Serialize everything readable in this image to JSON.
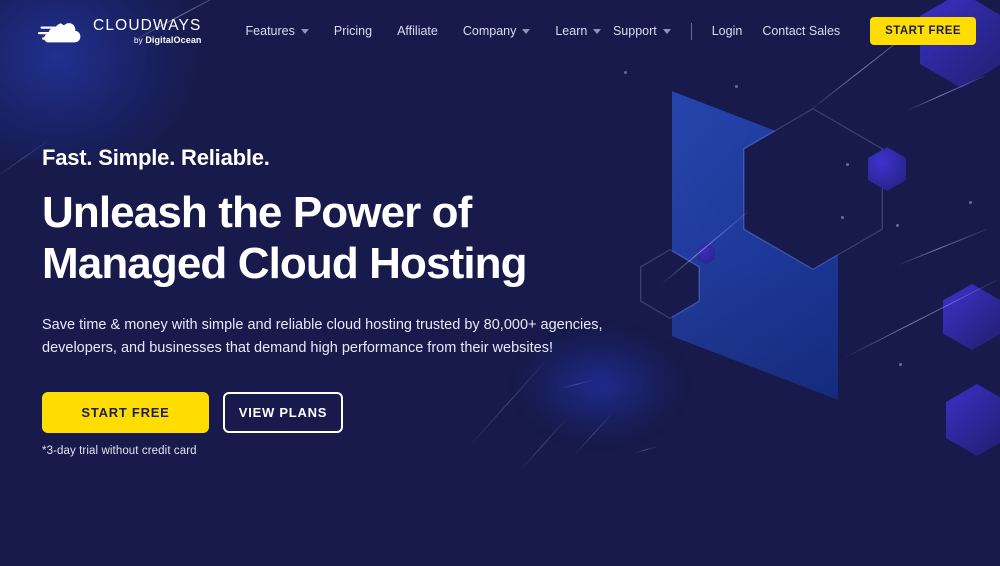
{
  "colors": {
    "background": "#171a4a",
    "accent_yellow": "#ffdd00",
    "accent_text_dark": "#1c1f52",
    "panel_blue": "#1a38a4",
    "hex_purple": "#3a31c8",
    "text_white": "#ffffff"
  },
  "header": {
    "logo": {
      "icon": "cloud-speed-icon",
      "title": "CLOUDWAYS",
      "by_label": "by",
      "parent_brand": "DigitalOcean"
    },
    "nav_main": [
      {
        "label": "Features",
        "has_dropdown": true,
        "icon": "chevron-down-icon"
      },
      {
        "label": "Pricing",
        "has_dropdown": false
      },
      {
        "label": "Affiliate",
        "has_dropdown": false
      },
      {
        "label": "Company",
        "has_dropdown": true,
        "icon": "chevron-down-icon"
      },
      {
        "label": "Learn",
        "has_dropdown": true,
        "icon": "chevron-down-icon"
      }
    ],
    "nav_right": [
      {
        "label": "Support",
        "has_dropdown": true,
        "icon": "chevron-down-icon"
      },
      {
        "label": "Login",
        "has_dropdown": false
      },
      {
        "label": "Contact Sales",
        "has_dropdown": false
      }
    ],
    "cta_button": "START FREE"
  },
  "hero": {
    "eyebrow": "Fast. Simple. Reliable.",
    "headline_line1": "Unleash the Power of",
    "headline_line2": "Managed Cloud Hosting",
    "subheading": "Save time & money with simple and reliable cloud hosting trusted by 80,000+ agencies, developers, and businesses that demand high performance from their websites!",
    "primary_cta": "START FREE",
    "secondary_cta": "VIEW PLANS",
    "trial_note": "*3-day trial without credit card"
  }
}
